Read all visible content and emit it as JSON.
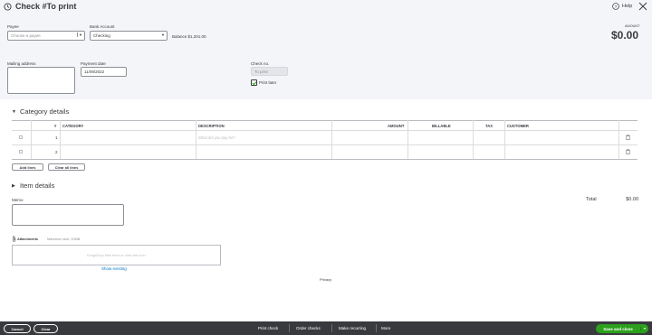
{
  "header": {
    "title": "Check #To print",
    "help_label": "Help",
    "amount_label": "AMOUNT",
    "amount_value": "$0.00"
  },
  "form": {
    "payee_label": "Payee",
    "payee_placeholder": "Choose a payee",
    "bank_account_label": "Bank Account",
    "bank_account_value": "Checking",
    "balance_text": "Balance $1,201.00",
    "mailing_label": "Mailing address",
    "payment_date_label": "Payment date",
    "payment_date_value": "11/09/2022",
    "check_no_label": "Check no.",
    "check_no_value": "To print",
    "print_later_label": "Print later"
  },
  "category": {
    "section_title": "Category details",
    "columns": {
      "num": "#",
      "category": "CATEGORY",
      "description": "DESCRIPTION",
      "amount": "AMOUNT",
      "billable": "BILLABLE",
      "tax": "TAX",
      "customer": "CUSTOMER"
    },
    "rows": [
      {
        "num": "1",
        "description_placeholder": "What did you pay for?"
      },
      {
        "num": "2",
        "description_placeholder": ""
      }
    ],
    "add_lines": "Add lines",
    "clear_all_lines": "Clear all lines"
  },
  "item": {
    "section_title": "Item details"
  },
  "memo": {
    "label": "Memo"
  },
  "totals": {
    "label": "Total",
    "value": "$0.00"
  },
  "attachments": {
    "label": "Attachments",
    "max_size": "Maximum size: 20MB",
    "drop_text": "Drag/Drop files here or click the icon",
    "show_existing": "Show existing"
  },
  "privacy": "Privacy",
  "footer": {
    "cancel": "Cancel",
    "clear": "Clear",
    "print_check": "Print check",
    "order_checks": "Order checks",
    "make_recurring": "Make recurring",
    "more": "More",
    "save_close": "Save and close"
  },
  "colors": {
    "footer_bg": "#393a3d",
    "primary_green": "#2ca01c",
    "link_blue": "#0077c5"
  }
}
